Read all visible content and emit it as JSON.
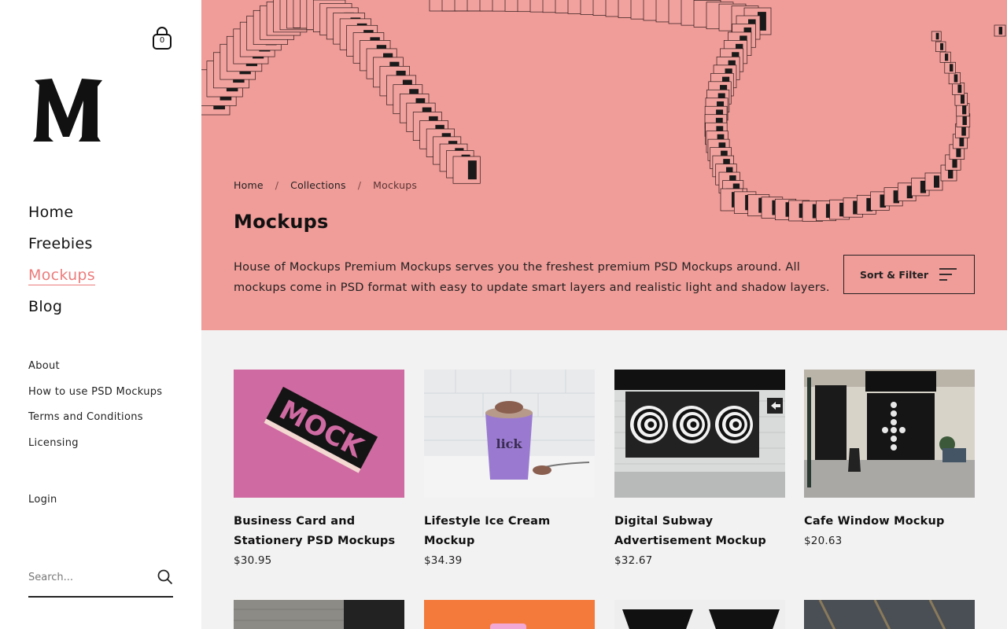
{
  "cart": {
    "count": "0"
  },
  "nav": {
    "main": [
      {
        "label": "Home"
      },
      {
        "label": "Freebies"
      },
      {
        "label": "Mockups"
      },
      {
        "label": "Blog"
      }
    ],
    "secondary": [
      {
        "label": "About"
      },
      {
        "label": "How to use PSD Mockups"
      },
      {
        "label": "Terms and Conditions"
      },
      {
        "label": "Licensing"
      }
    ],
    "login": "Login"
  },
  "search": {
    "placeholder": "Search..."
  },
  "breadcrumb": {
    "home": "Home",
    "collections": "Collections",
    "current": "Mockups",
    "separator": "/"
  },
  "page": {
    "title": "Mockups",
    "description": "House of Mockups Premium Mockups serves you the freshest premium PSD Mockups around. All mockups come in PSD format with easy to update smart layers and realistic light and shadow layers."
  },
  "sort_filter": {
    "label": "Sort & Filter"
  },
  "colors": {
    "accent": "#ec7c7c",
    "hero_bg": "#f09c98"
  },
  "products": [
    {
      "title": "Business Card and Stationery PSD Mockups",
      "price": "$30.95"
    },
    {
      "title": "Lifestyle Ice Cream Mockup",
      "price": "$34.39"
    },
    {
      "title": "Digital Subway Advertisement Mockup",
      "price": "$32.67"
    },
    {
      "title": "Cafe Window Mockup",
      "price": "$20.63"
    }
  ]
}
